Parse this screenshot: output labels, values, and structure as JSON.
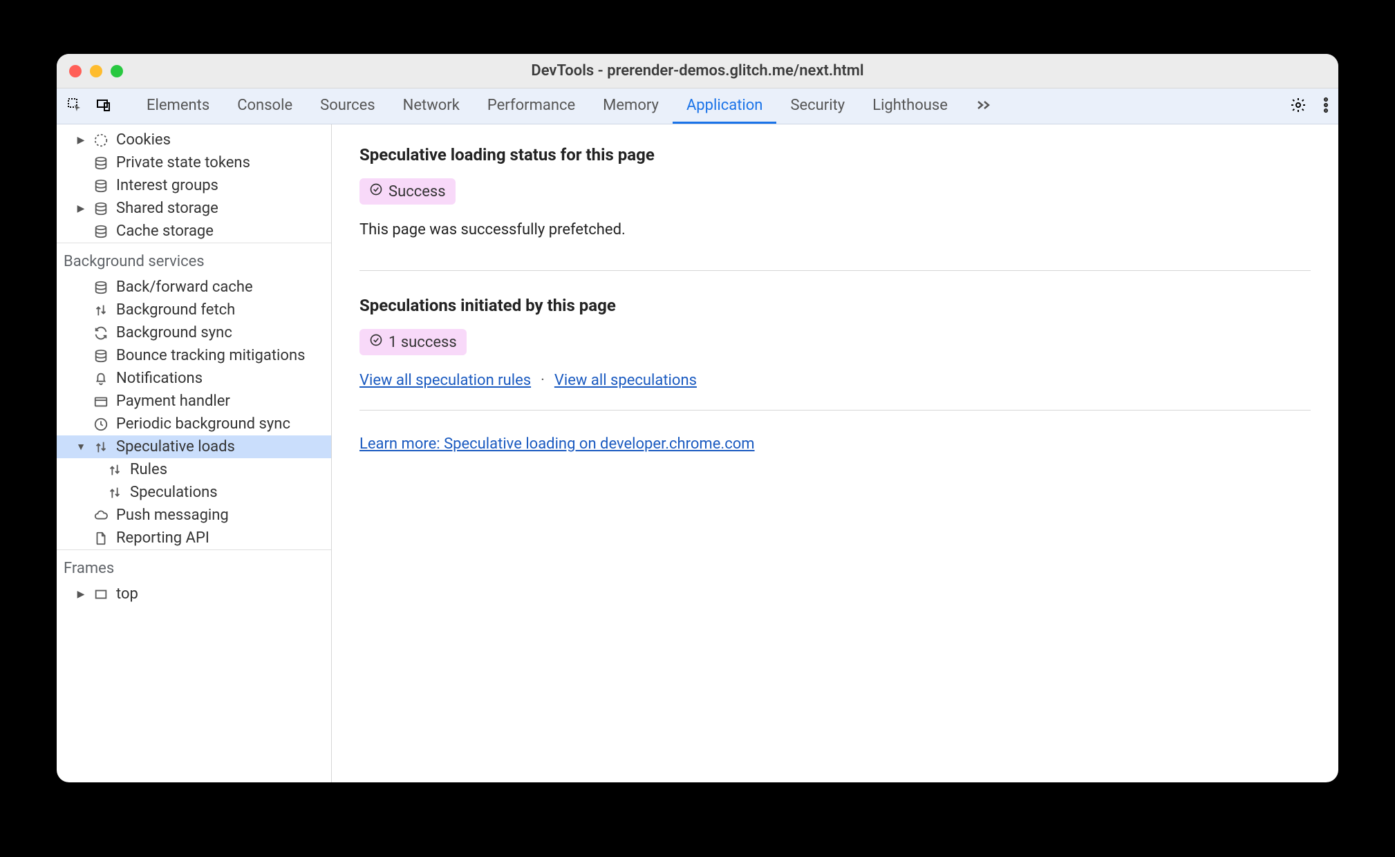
{
  "window": {
    "title": "DevTools - prerender-demos.glitch.me/next.html"
  },
  "tabs": {
    "items": [
      {
        "label": "Elements"
      },
      {
        "label": "Console"
      },
      {
        "label": "Sources"
      },
      {
        "label": "Network"
      },
      {
        "label": "Performance"
      },
      {
        "label": "Memory"
      },
      {
        "label": "Application"
      },
      {
        "label": "Security"
      },
      {
        "label": "Lighthouse"
      }
    ],
    "active": "Application"
  },
  "sidebar": {
    "storage_items": [
      {
        "label": "Cookies",
        "icon": "cookie",
        "collapsible": true
      },
      {
        "label": "Private state tokens",
        "icon": "database"
      },
      {
        "label": "Interest groups",
        "icon": "database"
      },
      {
        "label": "Shared storage",
        "icon": "database",
        "collapsible": true
      },
      {
        "label": "Cache storage",
        "icon": "database"
      }
    ],
    "bg_header": "Background services",
    "bg_items": [
      {
        "label": "Back/forward cache",
        "icon": "database"
      },
      {
        "label": "Background fetch",
        "icon": "updown"
      },
      {
        "label": "Background sync",
        "icon": "sync"
      },
      {
        "label": "Bounce tracking mitigations",
        "icon": "database"
      },
      {
        "label": "Notifications",
        "icon": "bell"
      },
      {
        "label": "Payment handler",
        "icon": "card"
      },
      {
        "label": "Periodic background sync",
        "icon": "clock"
      },
      {
        "label": "Speculative loads",
        "icon": "updown",
        "selected": true,
        "expanded": true
      },
      {
        "label": "Rules",
        "icon": "updown",
        "child": true
      },
      {
        "label": "Speculations",
        "icon": "updown",
        "child": true
      },
      {
        "label": "Push messaging",
        "icon": "cloud"
      },
      {
        "label": "Reporting API",
        "icon": "doc"
      }
    ],
    "frames_header": "Frames",
    "frames_items": [
      {
        "label": "top",
        "icon": "frame",
        "collapsible": true
      }
    ]
  },
  "main": {
    "status_heading": "Speculative loading status for this page",
    "status_badge": "Success",
    "status_text": "This page was successfully prefetched.",
    "initiated_heading": "Speculations initiated by this page",
    "initiated_badge": "1 success",
    "link_rules": "View all speculation rules",
    "link_speculations": "View all speculations",
    "learn_more": "Learn more: Speculative loading on developer.chrome.com"
  }
}
